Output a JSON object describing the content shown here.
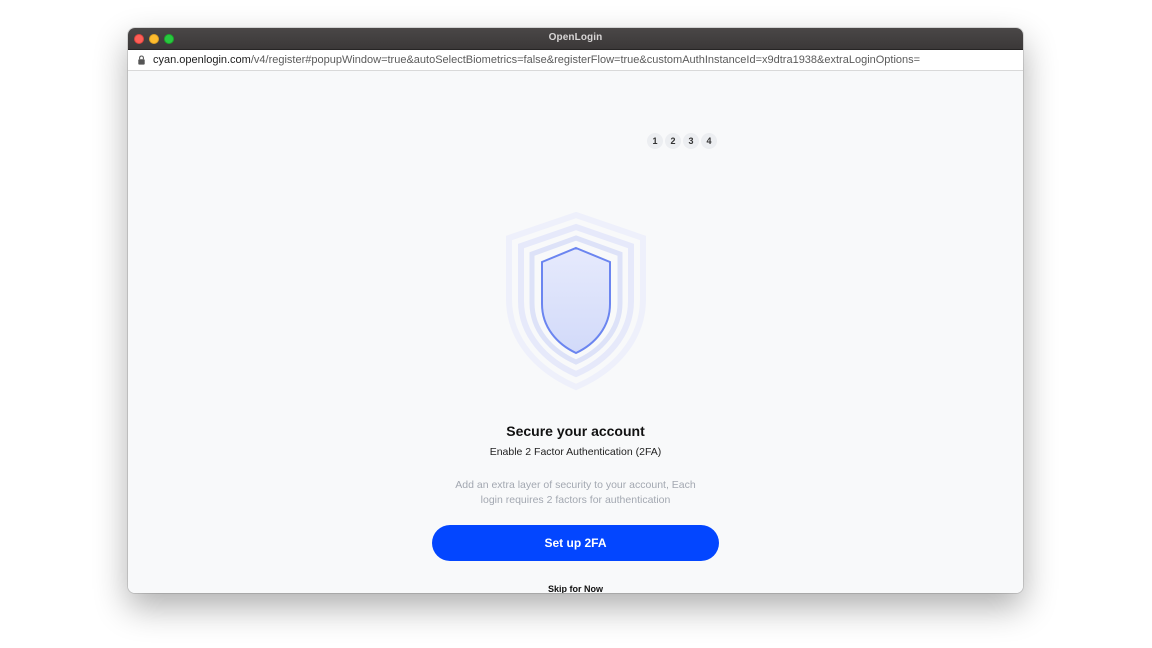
{
  "window": {
    "title": "OpenLogin"
  },
  "address_bar": {
    "host": "cyan.openlogin.com",
    "path": "/v4/register#popupWindow=true&autoSelectBiometrics=false&registerFlow=true&customAuthInstanceId=x9dtra1938&extraLoginOptions="
  },
  "stepper": {
    "steps": [
      "1",
      "2",
      "3",
      "4"
    ]
  },
  "illustration": {
    "icon": "shield-icon",
    "colors": {
      "shield_stroke": "#6b85f0",
      "shield_fill": "#dfe4fb",
      "glow_ring": "#e9ecfb"
    }
  },
  "main": {
    "heading": "Secure your account",
    "subheading": "Enable 2 Factor Authentication (2FA)",
    "description_line1": "Add an extra layer of security to your account, Each",
    "description_line2": "login requires 2 factors for authentication",
    "primary_button_label": "Set up 2FA",
    "skip_label": "Skip for Now"
  },
  "colors": {
    "accent": "#0346ff",
    "background": "#f8f9fa"
  }
}
